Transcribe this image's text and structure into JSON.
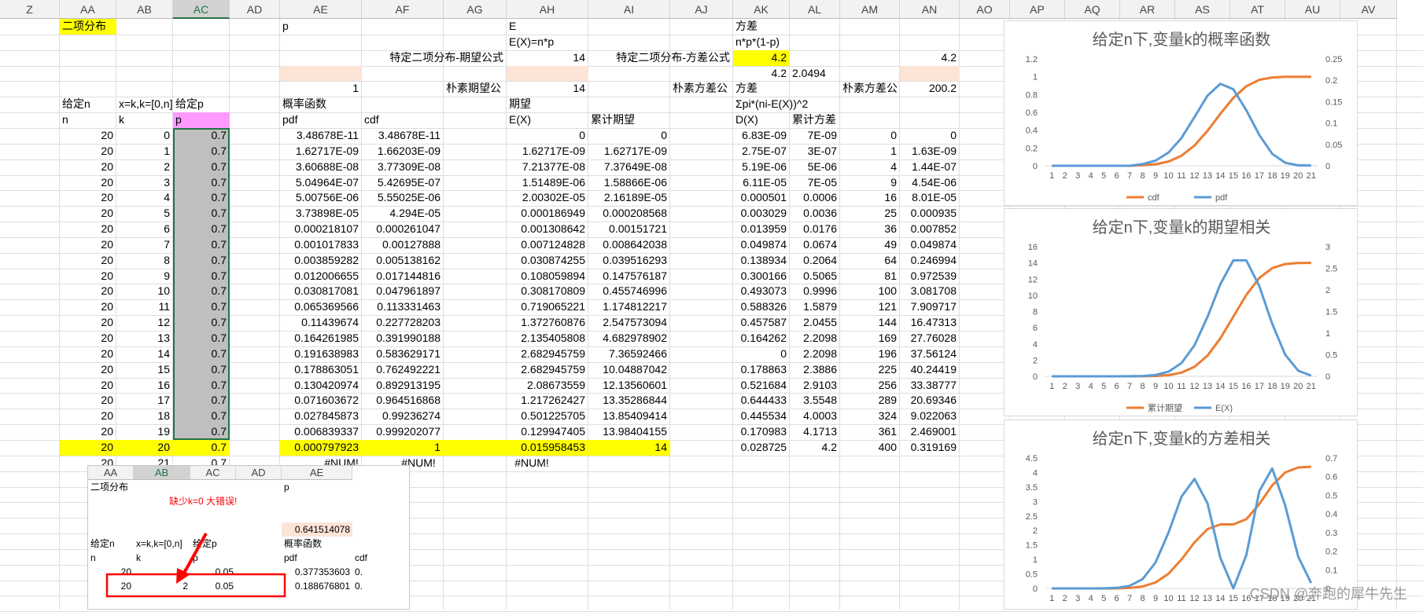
{
  "sheet": {
    "columns": [
      "Z",
      "AA",
      "AB",
      "AC",
      "AD",
      "AE",
      "AF",
      "AG",
      "AH",
      "AI",
      "AJ",
      "AK",
      "AL",
      "AM",
      "AN",
      "AO",
      "AP",
      "AQ",
      "AR",
      "AS",
      "AT",
      "AU",
      "AV"
    ],
    "selected_column": "AC",
    "top": {
      "title": "二项分布",
      "p_label": "p",
      "e_label": "E",
      "e_formula": "E(X)=n*p",
      "var_label": "方差",
      "var_formula": "n*p*(1-p)",
      "expect_formula_label": "特定二项分布-期望公式",
      "expect_formula_value": "14",
      "var_formula_label": "特定二项分布-方差公式",
      "var_formula_value": "4.2",
      "var_formula_value2": "4.2",
      "var_small": "4.2",
      "var_sqrt": "2.0494",
      "pdf_sum": "1",
      "naive_expect_label": "朴素期望公",
      "naive_expect_value": "14",
      "naive_var_label": "朴素方差公",
      "naive_var_value": "200.2",
      "var_header2": "方差",
      "given_n": "给定n",
      "x_range": "x=k,k=[0,n]",
      "given_p": "给定p",
      "prob_func": "概率函数",
      "expect_label": "期望",
      "var_sum_formula": "Σpi*(ni-E(X))^2",
      "n": "n",
      "k": "k",
      "p": "p",
      "pdf": "pdf",
      "cdf": "cdf",
      "ex": "E(X)",
      "cum_expect": "累计期望",
      "dx": "D(X)",
      "cum_var": "累计方差"
    },
    "rows": [
      [
        "20",
        "0",
        "0.7",
        "3.48678E-11",
        "3.48678E-11",
        "0",
        "0",
        "6.83E-09",
        "7E-09",
        "0",
        "0"
      ],
      [
        "20",
        "1",
        "0.7",
        "1.62717E-09",
        "1.66203E-09",
        "1.62717E-09",
        "1.62717E-09",
        "2.75E-07",
        "3E-07",
        "1",
        "1.63E-09"
      ],
      [
        "20",
        "2",
        "0.7",
        "3.60688E-08",
        "3.77309E-08",
        "7.21377E-08",
        "7.37649E-08",
        "5.19E-06",
        "5E-06",
        "4",
        "1.44E-07"
      ],
      [
        "20",
        "3",
        "0.7",
        "5.04964E-07",
        "5.42695E-07",
        "1.51489E-06",
        "1.58866E-06",
        "6.11E-05",
        "7E-05",
        "9",
        "4.54E-06"
      ],
      [
        "20",
        "4",
        "0.7",
        "5.00756E-06",
        "5.55025E-06",
        "2.00302E-05",
        "2.16189E-05",
        "0.000501",
        "0.0006",
        "16",
        "8.01E-05"
      ],
      [
        "20",
        "5",
        "0.7",
        "3.73898E-05",
        "4.294E-05",
        "0.000186949",
        "0.000208568",
        "0.003029",
        "0.0036",
        "25",
        "0.000935"
      ],
      [
        "20",
        "6",
        "0.7",
        "0.000218107",
        "0.000261047",
        "0.001308642",
        "0.00151721",
        "0.013959",
        "0.0176",
        "36",
        "0.007852"
      ],
      [
        "20",
        "7",
        "0.7",
        "0.001017833",
        "0.00127888",
        "0.007124828",
        "0.008642038",
        "0.049874",
        "0.0674",
        "49",
        "0.049874"
      ],
      [
        "20",
        "8",
        "0.7",
        "0.003859282",
        "0.005138162",
        "0.030874255",
        "0.039516293",
        "0.138934",
        "0.2064",
        "64",
        "0.246994"
      ],
      [
        "20",
        "9",
        "0.7",
        "0.012006655",
        "0.017144816",
        "0.108059894",
        "0.147576187",
        "0.300166",
        "0.5065",
        "81",
        "0.972539"
      ],
      [
        "20",
        "10",
        "0.7",
        "0.030817081",
        "0.047961897",
        "0.308170809",
        "0.455746996",
        "0.493073",
        "0.9996",
        "100",
        "3.081708"
      ],
      [
        "20",
        "11",
        "0.7",
        "0.065369566",
        "0.113331463",
        "0.719065221",
        "1.174812217",
        "0.588326",
        "1.5879",
        "121",
        "7.909717"
      ],
      [
        "20",
        "12",
        "0.7",
        "0.11439674",
        "0.227728203",
        "1.372760876",
        "2.547573094",
        "0.457587",
        "2.0455",
        "144",
        "16.47313"
      ],
      [
        "20",
        "13",
        "0.7",
        "0.164261985",
        "0.391990188",
        "2.135405808",
        "4.682978902",
        "0.164262",
        "2.2098",
        "169",
        "27.76028"
      ],
      [
        "20",
        "14",
        "0.7",
        "0.191638983",
        "0.583629171",
        "2.682945759",
        "7.36592466",
        "0",
        "2.2098",
        "196",
        "37.56124"
      ],
      [
        "20",
        "15",
        "0.7",
        "0.178863051",
        "0.762492221",
        "2.682945759",
        "10.04887042",
        "0.178863",
        "2.3886",
        "225",
        "40.24419"
      ],
      [
        "20",
        "16",
        "0.7",
        "0.130420974",
        "0.892913195",
        "2.08673559",
        "12.13560601",
        "0.521684",
        "2.9103",
        "256",
        "33.38777"
      ],
      [
        "20",
        "17",
        "0.7",
        "0.071603672",
        "0.964516868",
        "1.217262427",
        "13.35286844",
        "0.644433",
        "3.5548",
        "289",
        "20.69346"
      ],
      [
        "20",
        "18",
        "0.7",
        "0.027845873",
        "0.99236274",
        "0.501225705",
        "13.85409414",
        "0.445534",
        "4.0003",
        "324",
        "9.022063"
      ],
      [
        "20",
        "19",
        "0.7",
        "0.006839337",
        "0.999202077",
        "0.129947405",
        "13.98404155",
        "0.170983",
        "4.1713",
        "361",
        "2.469001"
      ],
      [
        "20",
        "20",
        "0.7",
        "0.000797923",
        "1",
        "0.015958453",
        "14",
        "0.028725",
        "4.2",
        "400",
        "0.319169"
      ]
    ],
    "error_row": [
      "20",
      "21",
      "0.7",
      "#NUM!",
      "#NUM!",
      "#NUM!"
    ]
  },
  "inset": {
    "columns": [
      "AA",
      "AB",
      "AC",
      "AD",
      "AE"
    ],
    "title": "二项分布",
    "p_label": "p",
    "warning": "缺少k=0  大错误!",
    "value": "0.641514078",
    "given_n": "给定n",
    "x_range": "x=k,k=[0,n]",
    "given_p": "给定p",
    "prob_func": "概率函数",
    "n": "n",
    "k": "k",
    "p": "p",
    "pdf": "pdf",
    "cdf": "cdf",
    "rows": [
      [
        "20",
        "1",
        "0.05",
        "0.377353603",
        "0."
      ],
      [
        "20",
        "2",
        "0.05",
        "0.188676801",
        "0."
      ]
    ]
  },
  "colors": {
    "yellow": "#FFFF00",
    "peach": "#FCE4D6",
    "pink": "#FF99FF",
    "gray_fill": "#BFBFBF",
    "orange_series": "#ED7D31",
    "blue_series": "#5B9BD5",
    "red_annotation": "#FF0000"
  },
  "watermark": "CSDN @奔跑的犀牛先生",
  "chart_data": [
    {
      "type": "line",
      "title": "给定n下,变量k的概率函数",
      "categories": [
        "1",
        "2",
        "3",
        "4",
        "5",
        "6",
        "7",
        "8",
        "9",
        "10",
        "11",
        "12",
        "13",
        "14",
        "15",
        "16",
        "17",
        "18",
        "19",
        "20",
        "21"
      ],
      "series": [
        {
          "name": "cdf",
          "axis": "left",
          "color": "#ED7D31",
          "values": [
            0,
            0,
            0,
            0,
            0,
            0,
            0,
            0.005,
            0.017,
            0.048,
            0.113,
            0.228,
            0.392,
            0.584,
            0.762,
            0.893,
            0.965,
            0.992,
            0.999,
            1,
            1
          ]
        },
        {
          "name": "pdf",
          "axis": "right",
          "color": "#5B9BD5",
          "values": [
            0,
            0,
            0,
            0,
            0,
            0,
            0,
            0.004,
            0.012,
            0.031,
            0.065,
            0.114,
            0.164,
            0.192,
            0.179,
            0.13,
            0.072,
            0.028,
            0.007,
            0.001,
            0.0008
          ]
        }
      ],
      "ylim_left": [
        0,
        1.2
      ],
      "yticks_left": [
        "0",
        "0.2",
        "0.4",
        "0.6",
        "0.8",
        "1",
        "1.2"
      ],
      "ylim_right": [
        0,
        0.25
      ],
      "yticks_right": [
        "0",
        "0.05",
        "0.1",
        "0.15",
        "0.2",
        "0.25"
      ],
      "legend": "bottom"
    },
    {
      "type": "line",
      "title": "给定n下,变量k的期望相关",
      "categories": [
        "1",
        "2",
        "3",
        "4",
        "5",
        "6",
        "7",
        "8",
        "9",
        "10",
        "11",
        "12",
        "13",
        "14",
        "15",
        "16",
        "17",
        "18",
        "19",
        "20",
        "21"
      ],
      "series": [
        {
          "name": "累计期望",
          "axis": "left",
          "color": "#ED7D31",
          "values": [
            0,
            0,
            0,
            0,
            0,
            0,
            0.002,
            0.009,
            0.04,
            0.148,
            0.456,
            1.175,
            2.548,
            4.683,
            7.366,
            10.049,
            12.136,
            13.353,
            13.854,
            13.984,
            14
          ]
        },
        {
          "name": "E(X)",
          "axis": "right",
          "color": "#5B9BD5",
          "values": [
            0,
            0,
            0,
            0,
            0,
            0,
            0.001,
            0.007,
            0.031,
            0.108,
            0.308,
            0.719,
            1.373,
            2.135,
            2.683,
            2.683,
            2.087,
            1.217,
            0.501,
            0.13,
            0.016
          ]
        }
      ],
      "ylim_left": [
        0,
        16
      ],
      "yticks_left": [
        "0",
        "2",
        "4",
        "6",
        "8",
        "10",
        "12",
        "14",
        "16"
      ],
      "ylim_right": [
        0,
        3
      ],
      "yticks_right": [
        "0",
        "0.5",
        "1",
        "1.5",
        "2",
        "2.5",
        "3"
      ],
      "legend": "bottom"
    },
    {
      "type": "line",
      "title": "给定n下,变量k的方差相关",
      "categories": [
        "1",
        "2",
        "3",
        "4",
        "5",
        "6",
        "7",
        "8",
        "9",
        "10",
        "11",
        "12",
        "13",
        "14",
        "15",
        "16",
        "17",
        "18",
        "19",
        "20",
        "21"
      ],
      "series": [
        {
          "name": "累计方差",
          "axis": "left",
          "color": "#ED7D31",
          "values": [
            0,
            0,
            0,
            0,
            0.0006,
            0.0036,
            0.0176,
            0.0674,
            0.2064,
            0.5065,
            0.9996,
            1.5879,
            2.0455,
            2.2098,
            2.2098,
            2.3886,
            2.9103,
            3.5548,
            4.0003,
            4.1713,
            4.2
          ]
        },
        {
          "name": "D(X)",
          "axis": "right",
          "color": "#5B9BD5",
          "values": [
            0,
            0,
            0,
            0,
            0.0005,
            0.003,
            0.014,
            0.05,
            0.139,
            0.3,
            0.493,
            0.588,
            0.458,
            0.164,
            0,
            0.179,
            0.522,
            0.644,
            0.446,
            0.171,
            0.029
          ]
        }
      ],
      "ylim_left": [
        0,
        4.5
      ],
      "yticks_left": [
        "0",
        "0.5",
        "1",
        "1.5",
        "2",
        "2.5",
        "3",
        "3.5",
        "4",
        "4.5"
      ],
      "ylim_right": [
        0,
        0.7
      ],
      "yticks_right": [
        "0",
        "0.1",
        "0.2",
        "0.3",
        "0.4",
        "0.5",
        "0.6",
        "0.7"
      ],
      "legend": "bottom"
    }
  ]
}
